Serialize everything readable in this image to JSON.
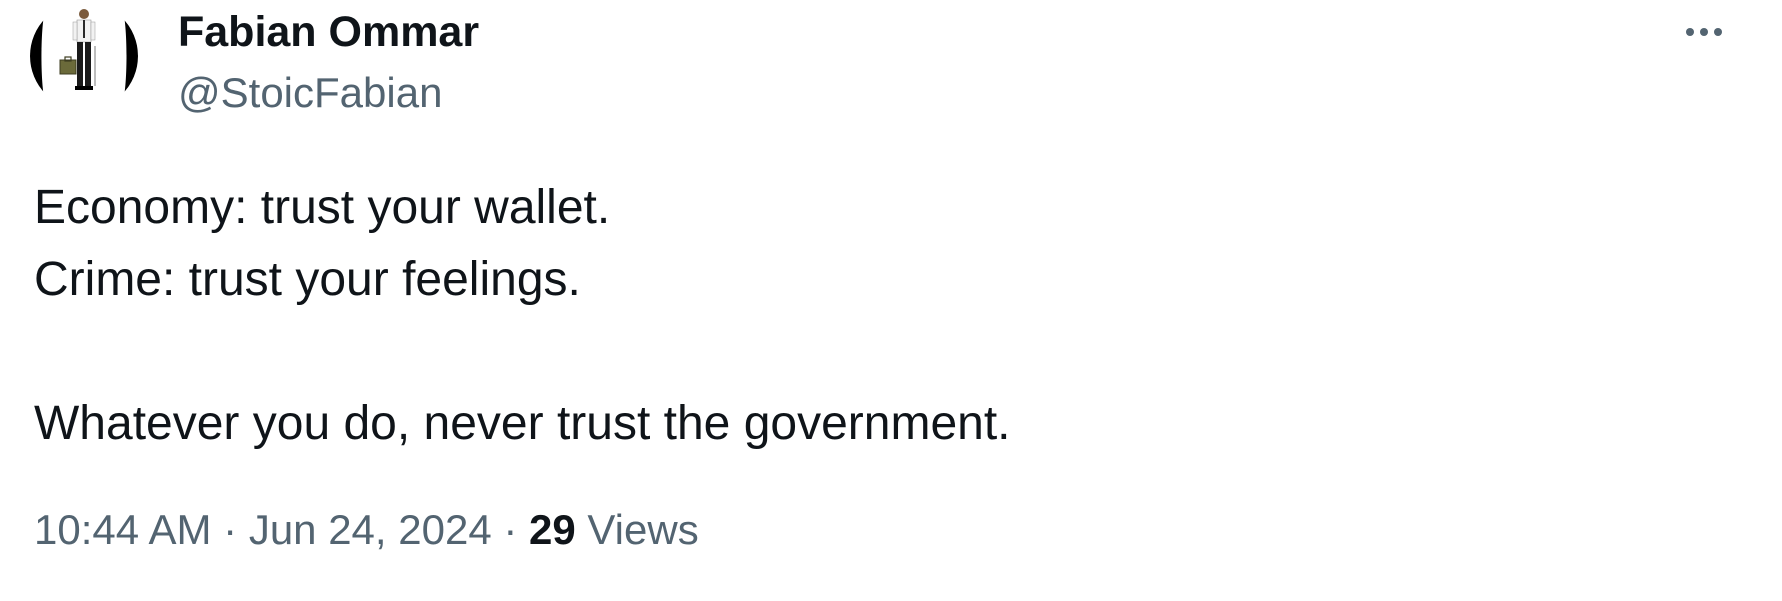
{
  "author": {
    "display_name": "Fabian Ommar",
    "handle": "@StoicFabian"
  },
  "tweet": {
    "lines": [
      "Economy: trust your wallet.",
      "Crime: trust your feelings.",
      "",
      "Whatever you do, never trust the government."
    ],
    "time": "10:44 AM",
    "separator": "·",
    "date": "Jun 24, 2024",
    "views_count": "29",
    "views_label": "Views"
  },
  "icons": {
    "more": "more-horizontal-icon",
    "avatar": "avatar-image"
  },
  "colors": {
    "text_primary": "#0f1419",
    "text_secondary": "#536471",
    "background": "#ffffff"
  }
}
